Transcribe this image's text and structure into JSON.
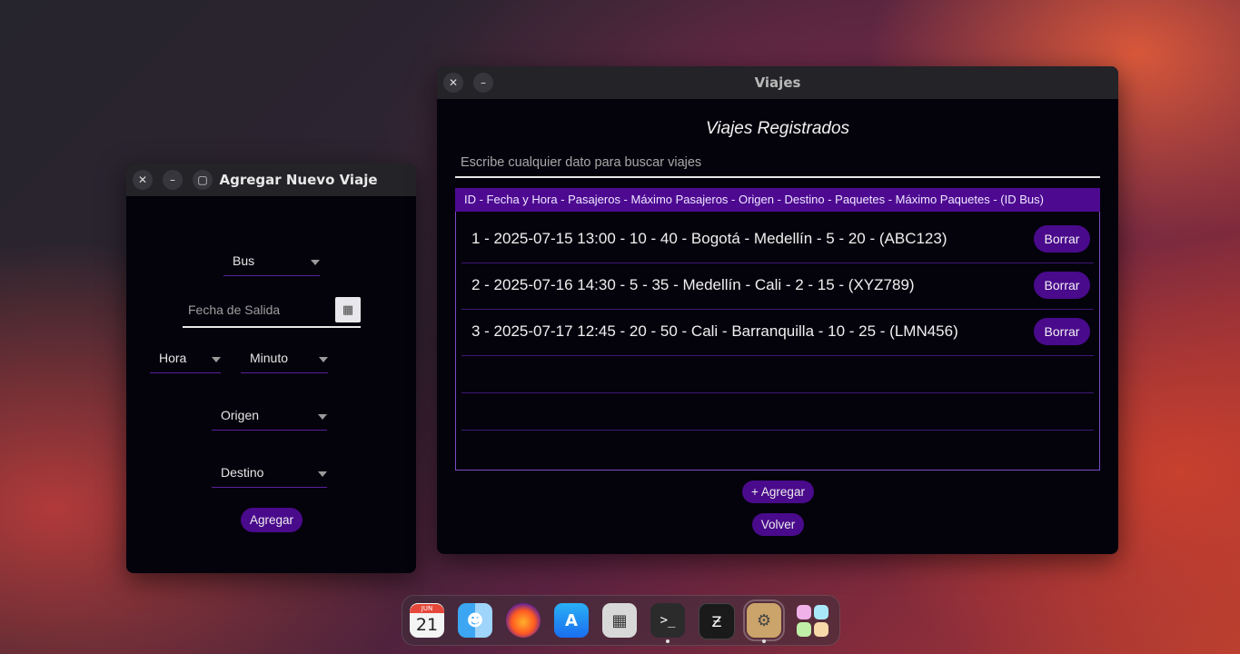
{
  "add_window": {
    "title": "Agregar Nuevo Viaje",
    "controls": {
      "close": "✕",
      "minimize": "–",
      "maximize": "▢"
    },
    "bus_select": "Bus",
    "date_placeholder": "Fecha de Salida",
    "calendar_icon": "▦",
    "hour_select": "Hora",
    "minute_select": "Minuto",
    "origin_select": "Origen",
    "destination_select": "Destino",
    "submit_label": "Agregar"
  },
  "trips_window": {
    "title": "Viajes",
    "controls": {
      "close": "✕",
      "minimize": "–"
    },
    "heading": "Viajes Registrados",
    "search_placeholder": "Escribe cualquier dato para buscar viajes",
    "table_header": "ID - Fecha y Hora - Pasajeros - Máximo Pasajeros - Origen - Destino - Paquetes - Máximo Paquetes - (ID Bus)",
    "rows": [
      {
        "text": "1 - 2025-07-15 13:00 - 10 - 40 - Bogotá - Medellín - 5 - 20 - (ABC123)",
        "delete_label": "Borrar"
      },
      {
        "text": "2 - 2025-07-16 14:30 - 5 - 35 - Medellín - Cali - 2 - 15 - (XYZ789)",
        "delete_label": "Borrar"
      },
      {
        "text": "3 - 2025-07-17 12:45 - 20 - 50 - Cali - Barranquilla - 10 - 25 - (LMN456)",
        "delete_label": "Borrar"
      }
    ],
    "add_label": "+ Agregar",
    "back_label": "Volver"
  },
  "dock": {
    "calendar_month": "JUN",
    "calendar_day": "21",
    "apps": [
      "calendar-icon",
      "finder-icon",
      "firefox-icon",
      "app-store-icon",
      "calculator-icon",
      "terminal-icon",
      "text-editor-icon",
      "system-preferences-icon",
      "launchpad-icon"
    ]
  }
}
